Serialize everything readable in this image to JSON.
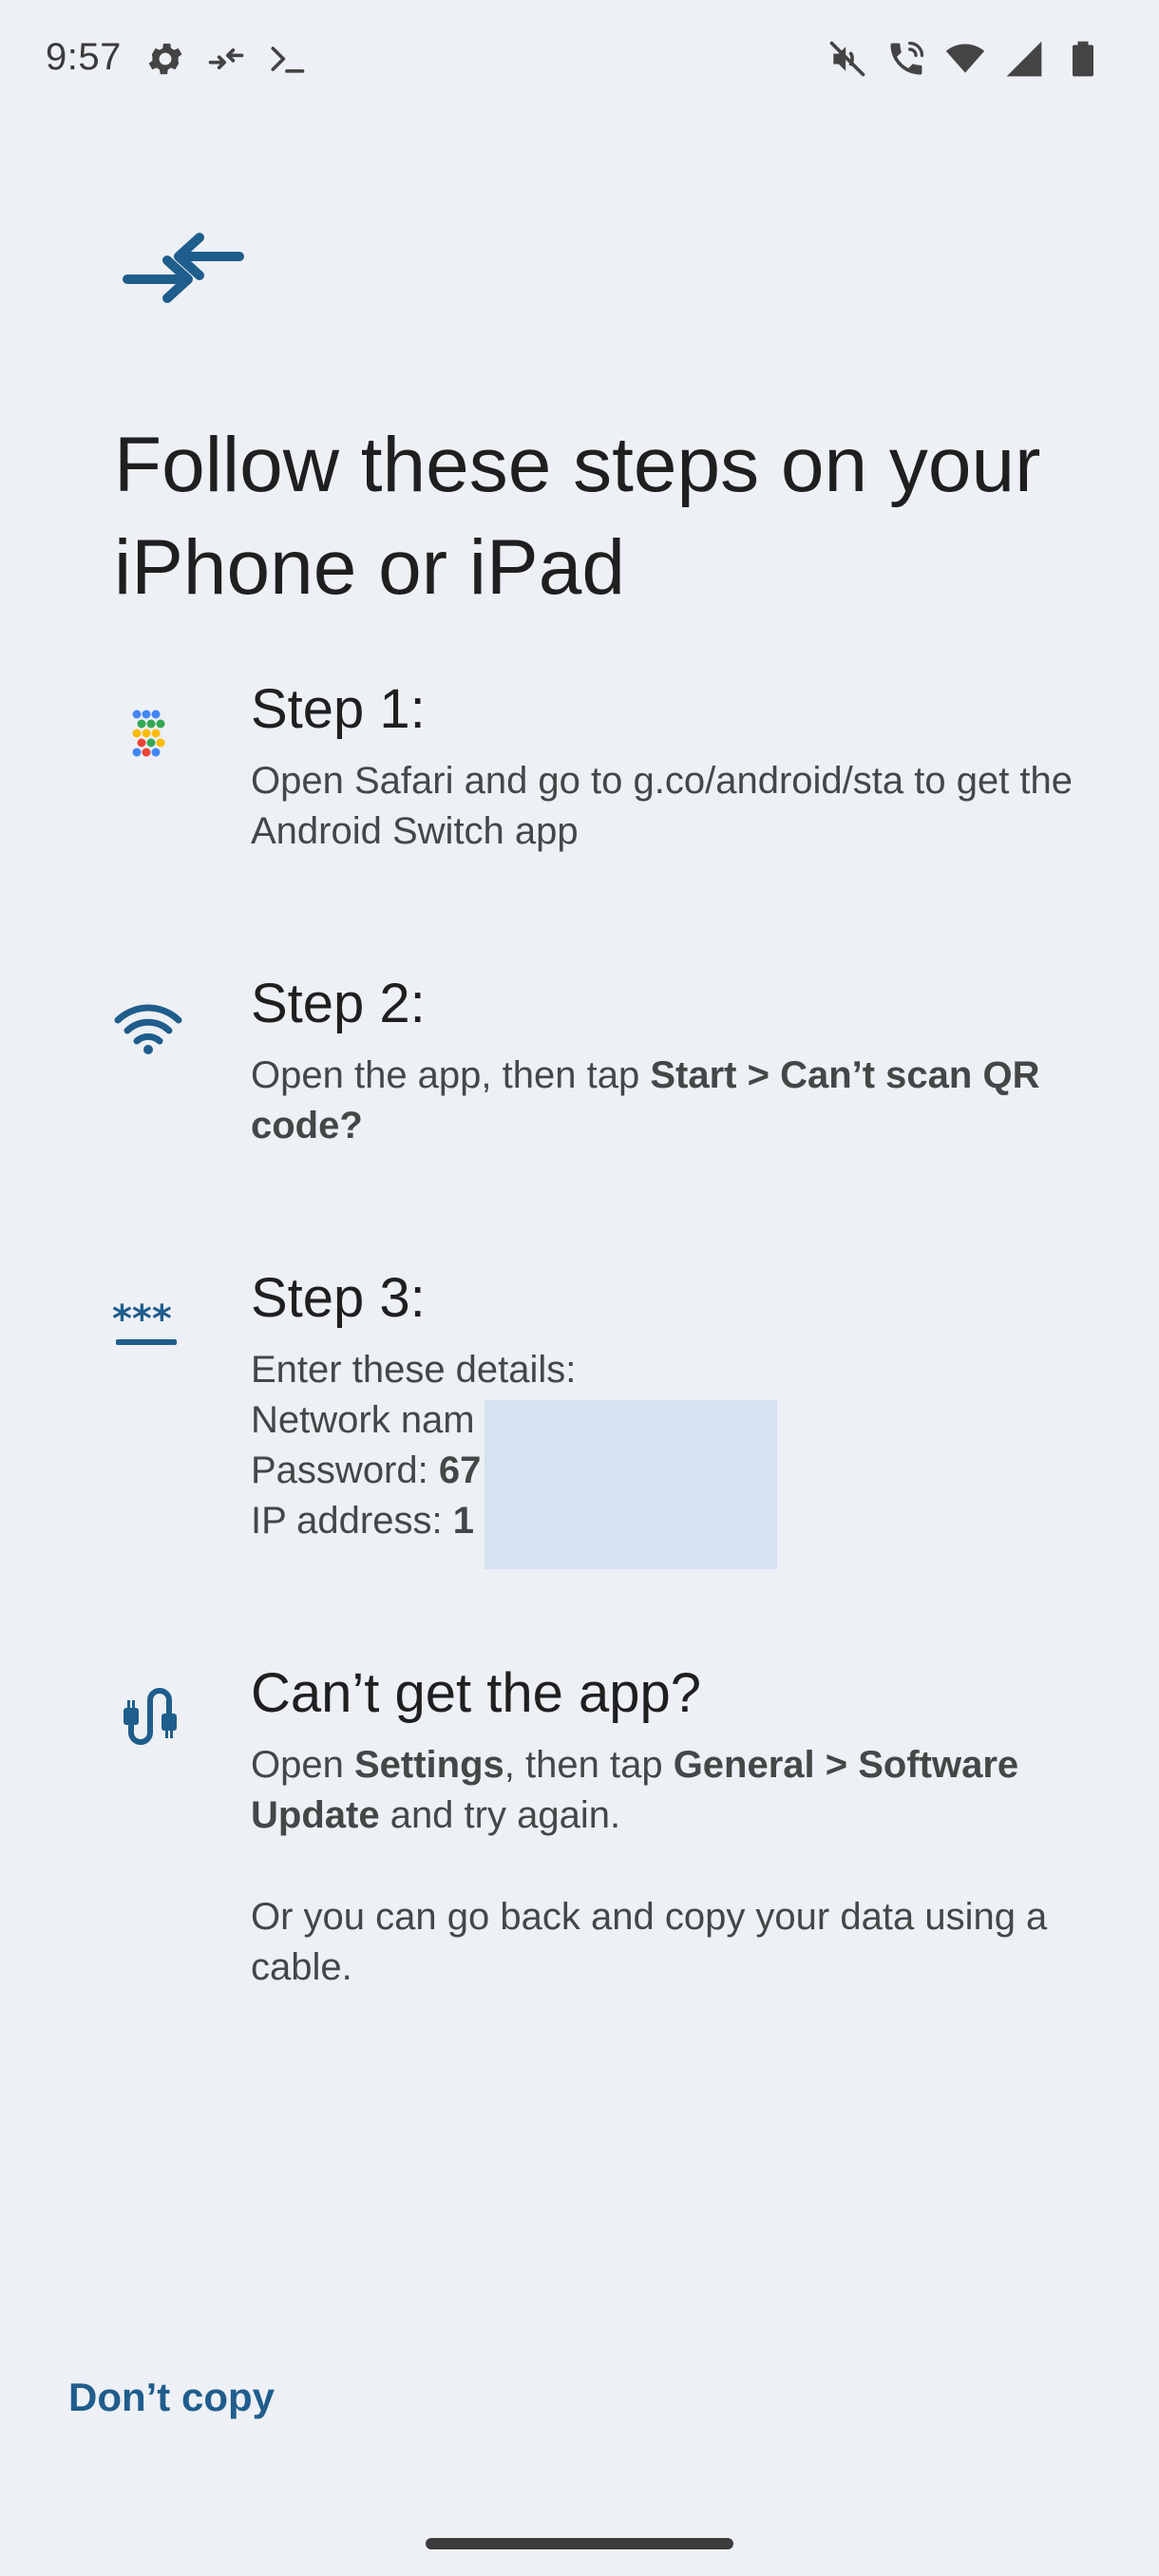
{
  "status_bar": {
    "time": "9:57",
    "left_icons": [
      "settings-icon",
      "switch-arrows-icon",
      "terminal-icon"
    ],
    "right_icons": [
      "vibrate-mute-icon",
      "wifi-calling-icon",
      "wifi-icon",
      "cell-signal-icon",
      "battery-icon"
    ]
  },
  "header": {
    "icon": "switch-arrows-icon",
    "title": "Follow these steps on your iPhone or iPad"
  },
  "steps": [
    {
      "icon": "app-dots-icon",
      "heading": "Step 1:",
      "text": "Open Safari and go to g.co/android/sta to get the Android Switch app"
    },
    {
      "icon": "wifi-icon",
      "heading": "Step 2:",
      "text_plain": "Open the app, then tap ",
      "text_bold": "Start > Can’t scan QR code?"
    },
    {
      "icon": "password-icon",
      "heading": "Step 3:",
      "intro": "Enter these details:",
      "network_label": "Network nam",
      "network_tail": "’",
      "password_label": "Password: ",
      "password_value": "67",
      "ip_label": "IP address: ",
      "ip_value": "1"
    }
  ],
  "cant_get_app": {
    "icon": "cable-icon",
    "heading": "Can’t get the app?",
    "p1_a": "Open ",
    "p1_b": "Settings",
    "p1_c": ", then tap ",
    "p1_d": "General > Software Update",
    "p1_e": " and try again.",
    "p2": "Or you can go back and copy your data using a cable."
  },
  "footer": {
    "dont_copy_label": "Don’t copy"
  },
  "colors": {
    "background": "#edf0f5",
    "accent": "#1f5d8c",
    "redaction": "#d5e2f2"
  }
}
